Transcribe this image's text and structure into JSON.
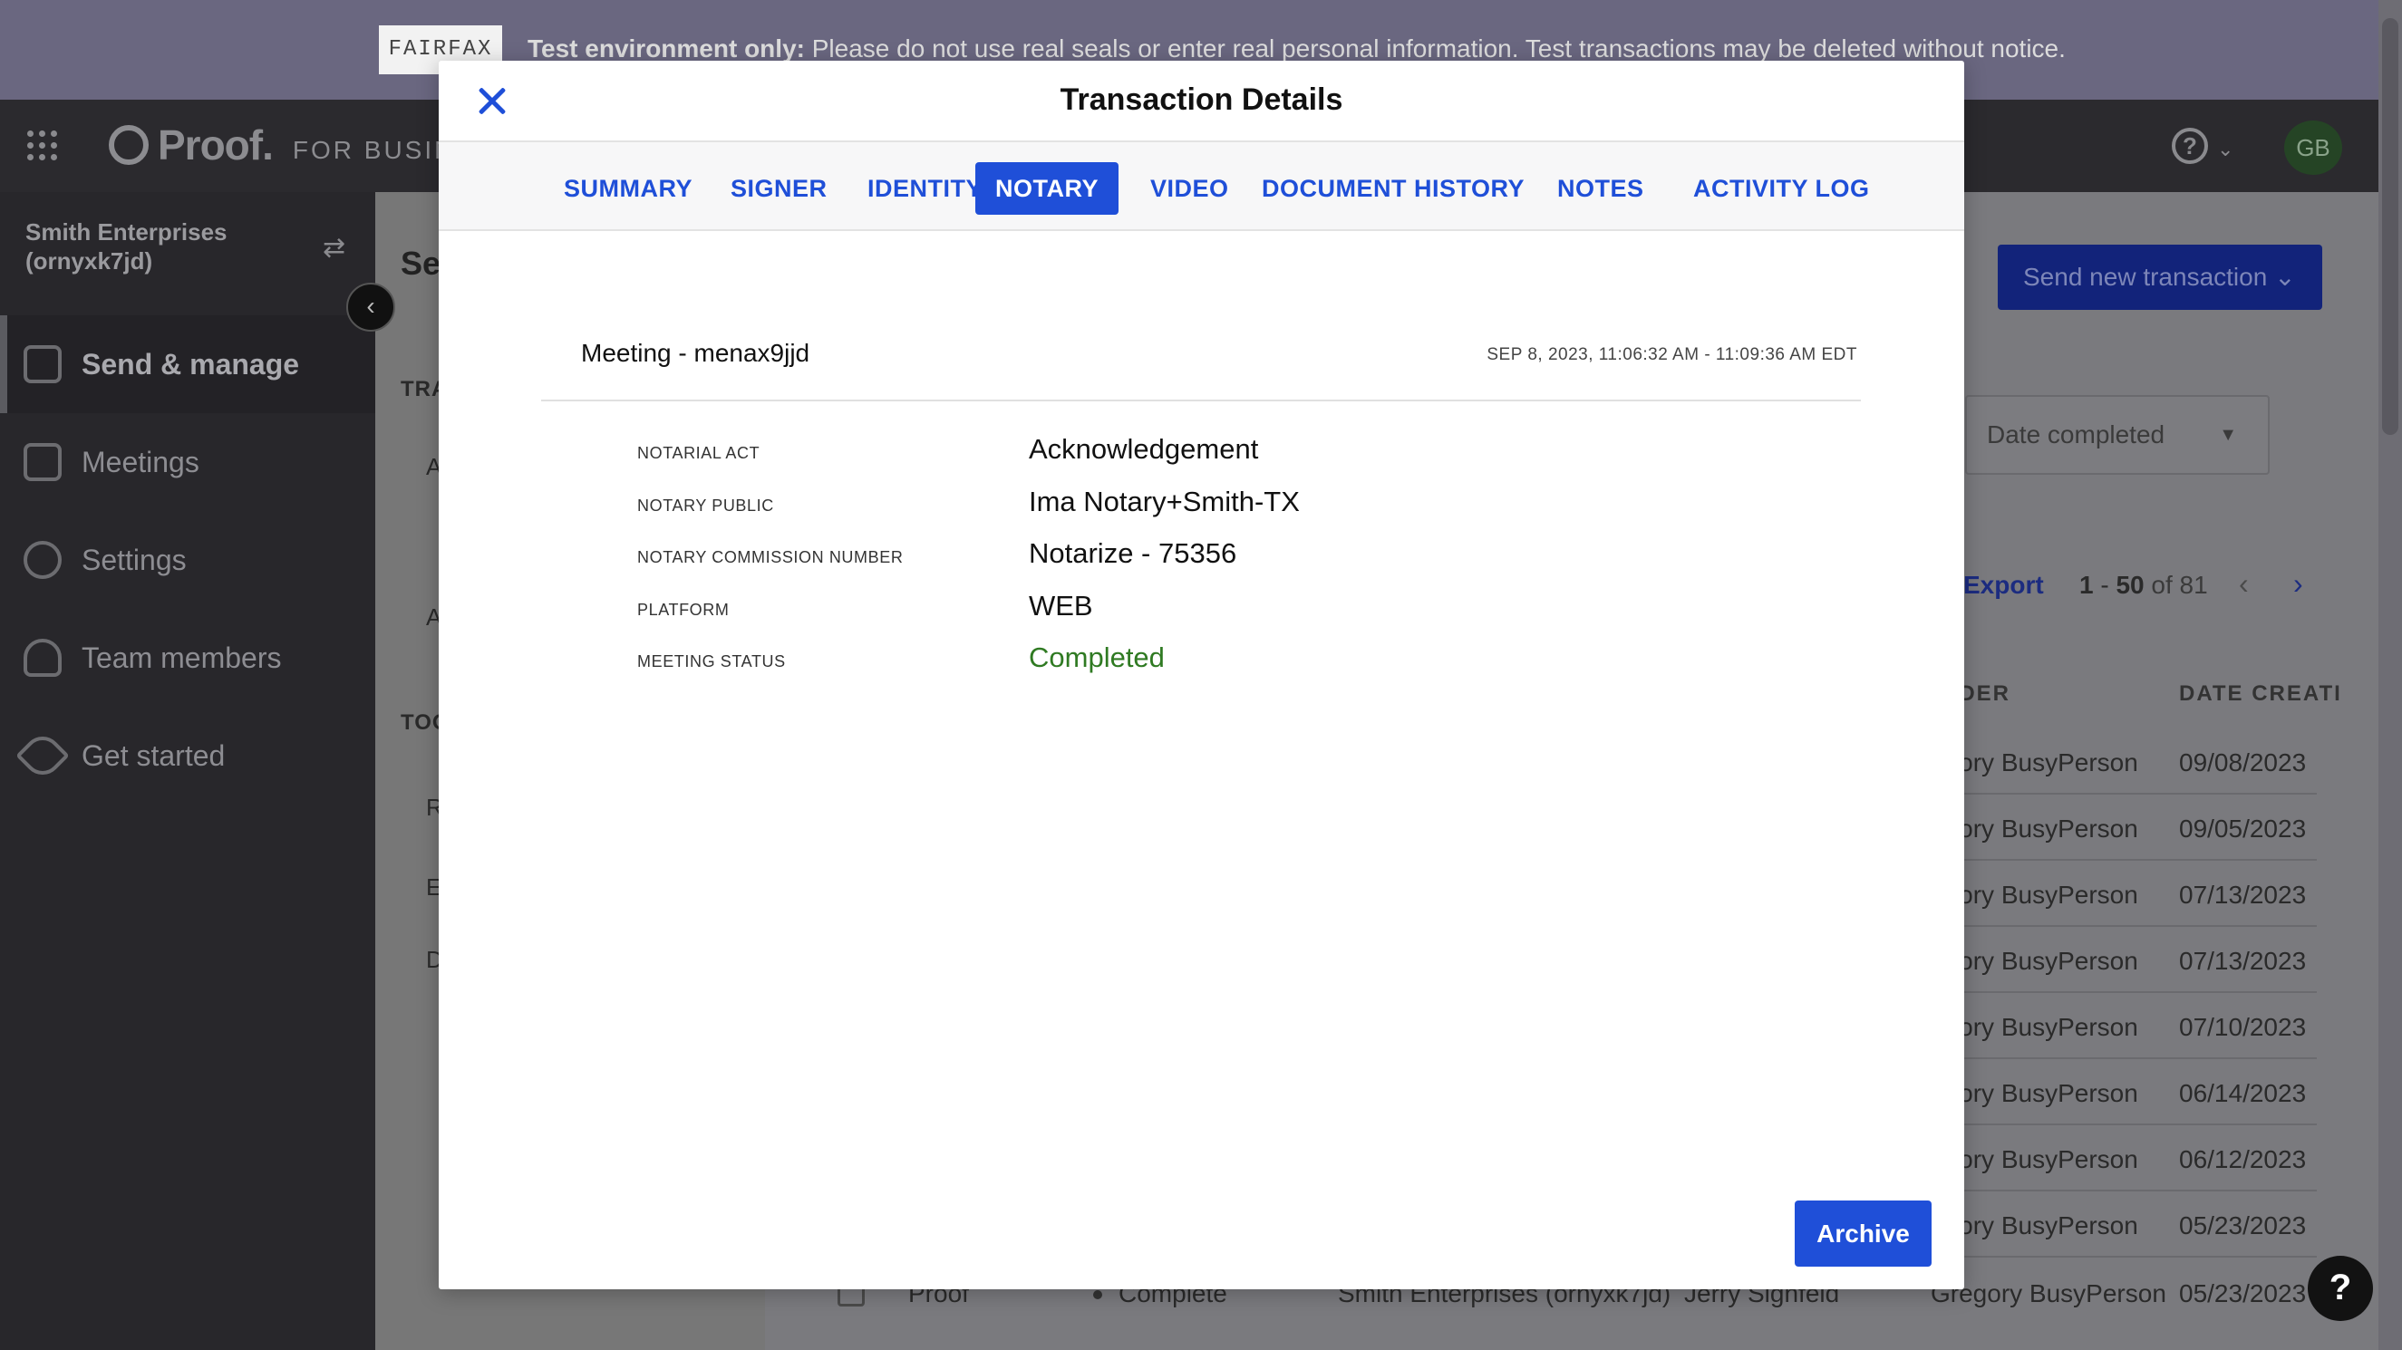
{
  "banner": {
    "logo_text": "FAIRFAX",
    "notice_bold": "Test environment only:",
    "notice_text": " Please do not use real seals or enter real personal information. Test transactions may be deleted without notice."
  },
  "topbar": {
    "brand_name": "Proof.",
    "brand_sub": "FOR BUSINESS",
    "help_icon": "?",
    "avatar_initials": "GB"
  },
  "sidebar": {
    "org_name": "Smith Enterprises (ornyxk7jd)",
    "nav": [
      {
        "label": "Send & manage",
        "icon": "grid-icon"
      },
      {
        "label": "Meetings",
        "icon": "calendar-icon"
      },
      {
        "label": "Settings",
        "icon": "gear-icon"
      },
      {
        "label": "Team members",
        "icon": "people-icon"
      },
      {
        "label": "Get started",
        "icon": "rocket-icon"
      }
    ]
  },
  "page": {
    "title": "Se",
    "section_transactions": "TRA",
    "section_tools": "TOO",
    "side_letters": [
      "A",
      "A",
      "R",
      "E",
      "D"
    ],
    "send_button": "Send new transaction",
    "date_filter": "Date completed",
    "export_label": "Export",
    "pager": {
      "from": "1",
      "to": "50",
      "total_text": "of 81"
    },
    "columns": {
      "sender": "NDER",
      "date_created": "DATE CREATI"
    },
    "rows": [
      {
        "sender": "egory BusyPerson",
        "date": "09/08/2023"
      },
      {
        "sender": "egory BusyPerson",
        "date": "09/05/2023"
      },
      {
        "sender": "egory BusyPerson",
        "date": "07/13/2023"
      },
      {
        "sender": "egory BusyPerson",
        "date": "07/13/2023"
      },
      {
        "sender": "egory BusyPerson",
        "date": "07/10/2023"
      },
      {
        "sender": "egory BusyPerson",
        "date": "06/14/2023"
      },
      {
        "sender": "egory BusyPerson",
        "date": "06/12/2023"
      },
      {
        "sender": "egory BusyPerson",
        "date": "05/23/2023"
      }
    ],
    "last_row": {
      "type": "Proof",
      "status": "Complete",
      "org": "Smith Enterprises (ornyxk7jd)",
      "signer": "Jerry Signfeld",
      "sender": "Gregory BusyPerson",
      "date": "05/23/2023"
    }
  },
  "modal": {
    "title": "Transaction Details",
    "tabs": [
      "SUMMARY",
      "SIGNER",
      "IDENTITY",
      "NOTARY",
      "VIDEO",
      "DOCUMENT",
      "HISTORY",
      "NOTES",
      "ACTIVITY LOG"
    ],
    "active_tab": "NOTARY",
    "meeting_title": "Meeting - menax9jjd",
    "meeting_time": "SEP 8, 2023, 11:06:32 AM - 11:09:36 AM EDT",
    "details": [
      {
        "label": "NOTARIAL ACT",
        "value": "Acknowledgement"
      },
      {
        "label": "NOTARY PUBLIC",
        "value": "Ima Notary+Smith-TX"
      },
      {
        "label": "NOTARY COMMISSION NUMBER",
        "value": "Notarize - 75356"
      },
      {
        "label": "PLATFORM",
        "value": "WEB"
      },
      {
        "label": "MEETING STATUS",
        "value": "Completed"
      }
    ],
    "archive_button": "Archive"
  },
  "colors": {
    "accent": "#1f4fd8",
    "status_completed": "#2f7a22"
  }
}
